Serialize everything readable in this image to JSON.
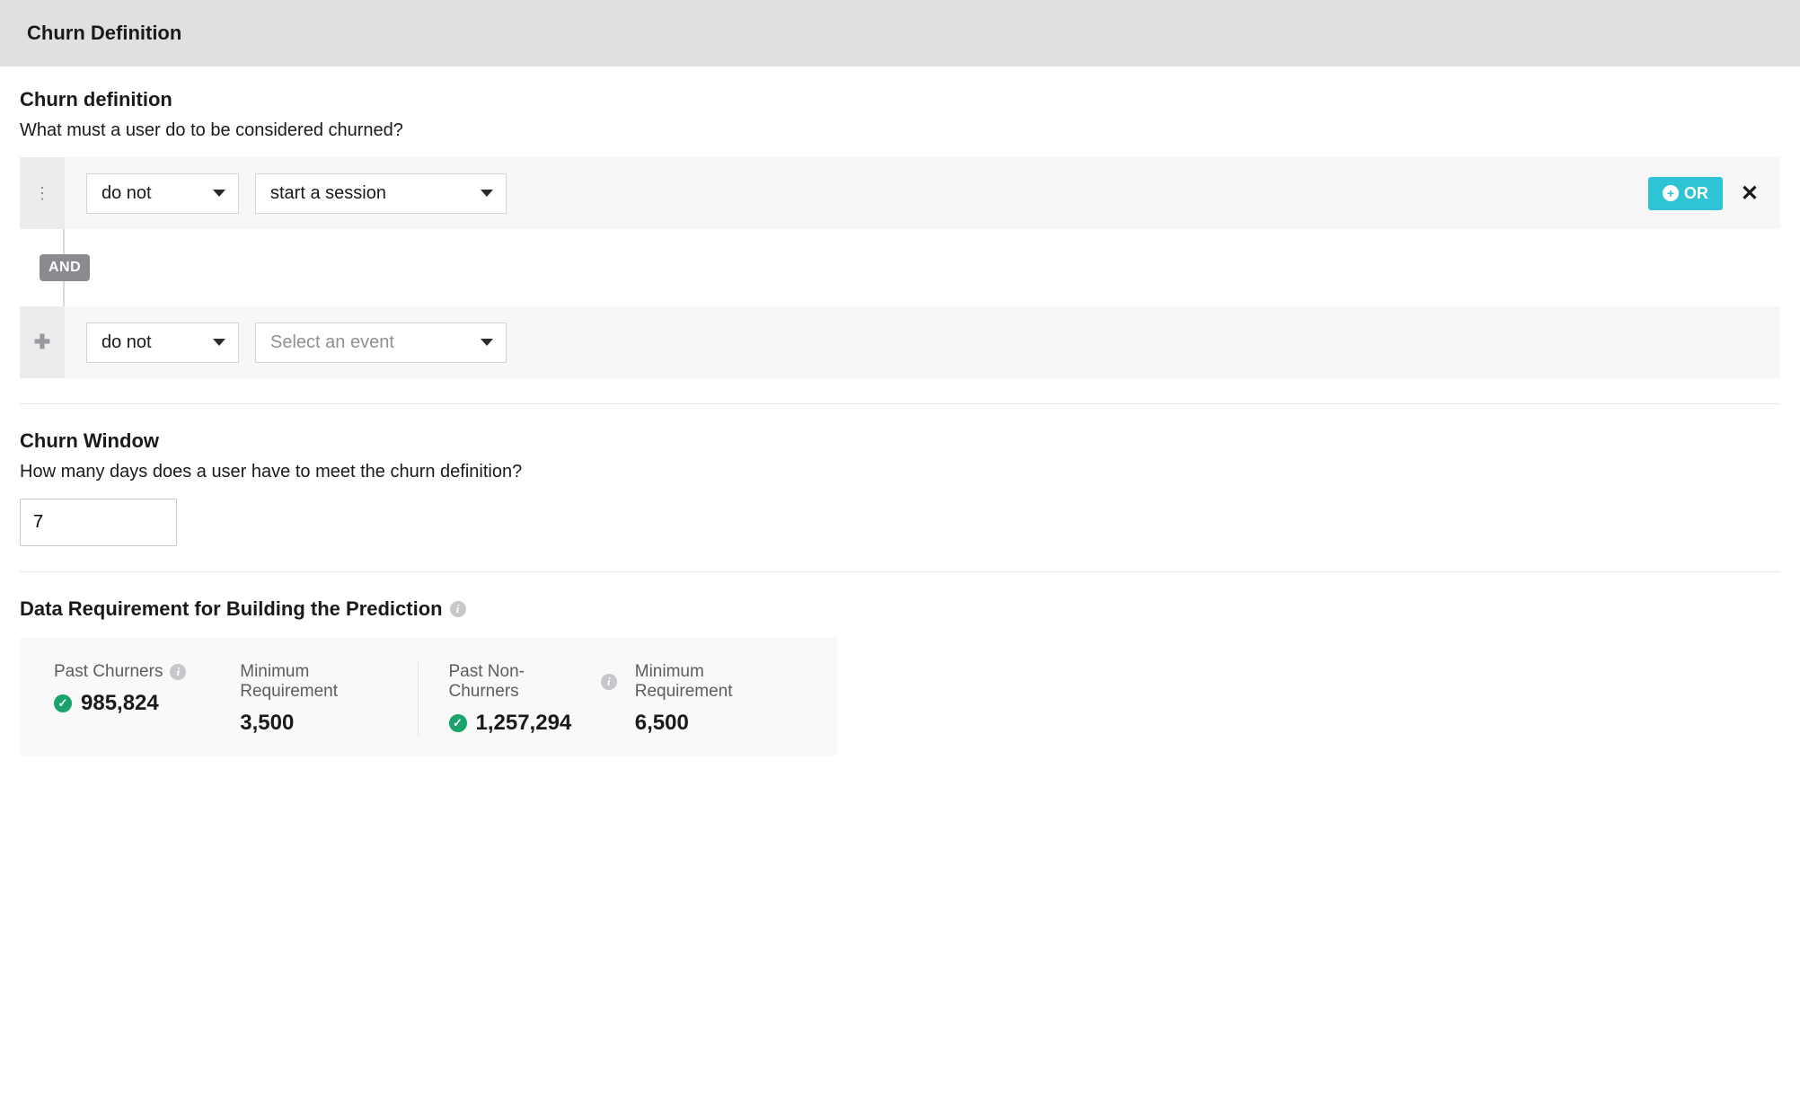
{
  "header": {
    "title": "Churn Definition"
  },
  "churnDefinition": {
    "title": "Churn definition",
    "subtitle": "What must a user do to be considered churned?",
    "rule1": {
      "condition": "do not",
      "event": "start a session",
      "orLabel": "OR"
    },
    "connector": "AND",
    "rule2": {
      "condition": "do not",
      "eventPlaceholder": "Select an event"
    }
  },
  "churnWindow": {
    "title": "Churn Window",
    "subtitle": "How many days does a user have to meet the churn definition?",
    "value": "7"
  },
  "dataReq": {
    "title": "Data Requirement for Building the Prediction",
    "pastChurners": {
      "label": "Past Churners",
      "value": "985,824"
    },
    "minReq1": {
      "label": "Minimum Requirement",
      "value": "3,500"
    },
    "pastNonChurners": {
      "label": "Past Non-Churners",
      "value": "1,257,294"
    },
    "minReq2": {
      "label": "Minimum Requirement",
      "value": "6,500"
    }
  }
}
